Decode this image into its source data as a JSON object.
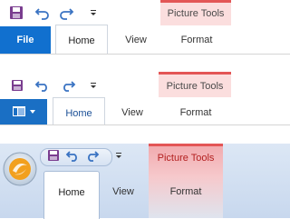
{
  "variants": [
    {
      "context_label": "Picture Tools",
      "file_label": "File",
      "tabs": [
        "Home",
        "View",
        "Format"
      ]
    },
    {
      "context_label": "Picture Tools",
      "tabs": [
        "Home",
        "View",
        "Format"
      ]
    },
    {
      "context_label": "Picture Tools",
      "tabs": [
        "Home",
        "View",
        "Format"
      ]
    }
  ],
  "colors": {
    "file_blue": "#1170cf",
    "context_red": "#e35656",
    "context_fill": "#fbdede",
    "qat_icon_purple": "#7a3d8f",
    "qat_icon_blue": "#3a73c2"
  },
  "icons": [
    "save-icon",
    "undo-icon",
    "redo-icon",
    "customize-qat-icon",
    "ribbon-app-menu-icon",
    "windows7-orb-icon"
  ]
}
